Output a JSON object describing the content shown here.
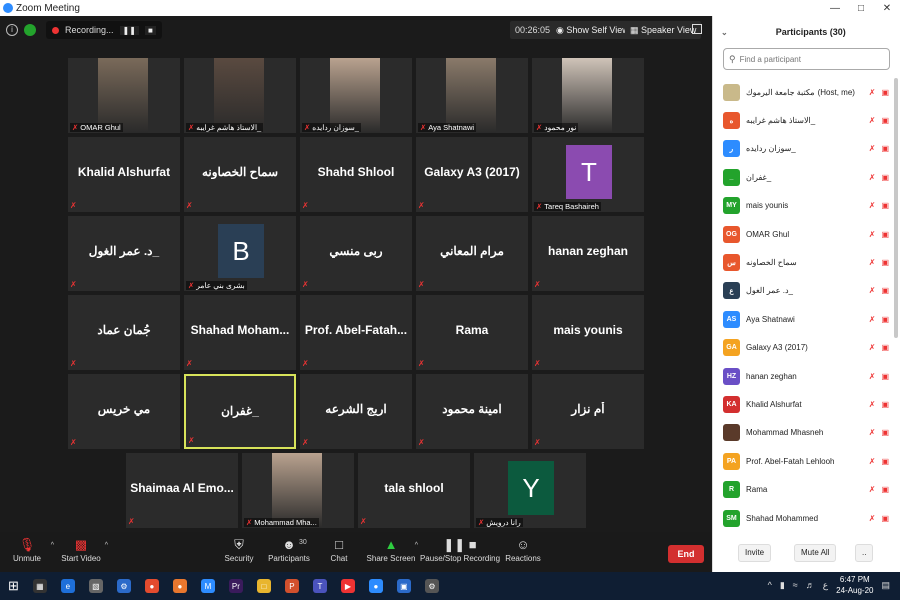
{
  "window": {
    "title": "Zoom Meeting"
  },
  "topbar": {
    "recording_label": "Recording...",
    "pause_icon": "pause-icon",
    "stop_icon": "stop-icon",
    "timer": "00:26:05",
    "self_view_label": "Show Self View",
    "speaker_view_label": "Speaker View"
  },
  "tiles": [
    {
      "name": "",
      "label": "OMAR Ghul",
      "kind": "video"
    },
    {
      "name": "",
      "label": "الاستاذ هاشم غرايبه_",
      "kind": "video"
    },
    {
      "name": "",
      "label": "سوزان ردايده_",
      "kind": "video"
    },
    {
      "name": "",
      "label": "Aya Shatnawi",
      "kind": "video"
    },
    {
      "name": "",
      "label": "نور محمود",
      "kind": "video"
    },
    {
      "name": "Khalid Alshurfat",
      "label": "",
      "kind": "text"
    },
    {
      "name": "سماح الخصاونه",
      "label": "",
      "kind": "text"
    },
    {
      "name": "Shahd Shlool",
      "label": "",
      "kind": "text"
    },
    {
      "name": "Galaxy A3 (2017)",
      "label": "",
      "kind": "text"
    },
    {
      "name": "",
      "label": "Tareq Bashaireh",
      "kind": "avatar",
      "letter": "T"
    },
    {
      "name": "د. عمر الغول_",
      "label": "",
      "kind": "text"
    },
    {
      "name": "",
      "label": "بشرى بني عامر",
      "kind": "avatar",
      "letter": "B"
    },
    {
      "name": "ربى منسي",
      "label": "",
      "kind": "text"
    },
    {
      "name": "مرام المعاني",
      "label": "",
      "kind": "text"
    },
    {
      "name": "hanan zeghan",
      "label": "",
      "kind": "text"
    },
    {
      "name": "جُمان عماد",
      "label": "",
      "kind": "text"
    },
    {
      "name": "Shahad  Moham...",
      "label": "",
      "kind": "text"
    },
    {
      "name": "Prof.  Abel-Fatah...",
      "label": "",
      "kind": "text"
    },
    {
      "name": "Rama",
      "label": "",
      "kind": "text"
    },
    {
      "name": "mais younis",
      "label": "",
      "kind": "text"
    },
    {
      "name": "مي خريس",
      "label": "",
      "kind": "text"
    },
    {
      "name": "غفران_",
      "label": "",
      "kind": "text",
      "active": true
    },
    {
      "name": "اريج الشرعه",
      "label": "",
      "kind": "text"
    },
    {
      "name": "امينة محمود",
      "label": "",
      "kind": "text"
    },
    {
      "name": "أم نزار",
      "label": "",
      "kind": "text"
    },
    {
      "name": "Shaimaa  Al  Emo...",
      "label": "",
      "kind": "text"
    },
    {
      "name": "",
      "label": "Mohammad Mha...",
      "kind": "video"
    },
    {
      "name": "tala shlool",
      "label": "",
      "kind": "text"
    },
    {
      "name": "",
      "label": "رانا درويش",
      "kind": "avatar",
      "letter": "Y"
    }
  ],
  "toolbar": {
    "unmute": "Unmute",
    "start_video": "Start Video",
    "security": "Security",
    "participants": "Participants",
    "participants_count": "30",
    "chat": "Chat",
    "share_screen": "Share Screen",
    "pause_recording": "Pause/Stop Recording",
    "reactions": "Reactions",
    "end": "End"
  },
  "panel": {
    "title": "Participants (30)",
    "search_placeholder": "Find a participant",
    "invite": "Invite",
    "mute_all": "Mute All",
    "more": "..",
    "participants": [
      {
        "initials": "",
        "name": "مكتبة جامعة اليرموك",
        "suffix": "(Host, me)",
        "color": "#c9b98a"
      },
      {
        "initials": "ه",
        "name": "الاستاذ هاشم غرايبه_",
        "suffix": "",
        "color": "#e8572d"
      },
      {
        "initials": "ر",
        "name": "سوزان ردايده_",
        "suffix": "",
        "color": "#2d8cff"
      },
      {
        "initials": "_",
        "name": "غفران_",
        "suffix": "",
        "color": "#23a32c"
      },
      {
        "initials": "MY",
        "name": "mais younis",
        "suffix": "",
        "color": "#23a32c"
      },
      {
        "initials": "OG",
        "name": "OMAR Ghul",
        "suffix": "",
        "color": "#e8572d"
      },
      {
        "initials": "س",
        "name": "سماح الخصاونه",
        "suffix": "",
        "color": "#e8572d"
      },
      {
        "initials": "ع",
        "name": "د. عمر الغول_",
        "suffix": "",
        "color": "#2a3f55"
      },
      {
        "initials": "AS",
        "name": "Aya Shatnawi",
        "suffix": "",
        "color": "#2d8cff"
      },
      {
        "initials": "GA",
        "name": "Galaxy A3 (2017)",
        "suffix": "",
        "color": "#f4a321"
      },
      {
        "initials": "HZ",
        "name": "hanan zeghan",
        "suffix": "",
        "color": "#6a4fc6"
      },
      {
        "initials": "KA",
        "name": "Khalid Alshurfat",
        "suffix": "",
        "color": "#d32f2f"
      },
      {
        "initials": "",
        "name": "Mohammad Mhasneh",
        "suffix": "",
        "color": "#5a3a2a"
      },
      {
        "initials": "PA",
        "name": "Prof. Abel-Fatah Lehlooh",
        "suffix": "",
        "color": "#f4a321"
      },
      {
        "initials": "R",
        "name": "Rama",
        "suffix": "",
        "color": "#23a32c"
      },
      {
        "initials": "SM",
        "name": "Shahad Mohammed",
        "suffix": "",
        "color": "#23a32c"
      }
    ]
  },
  "taskbar": {
    "time": "6:47 PM",
    "date": "24-Aug-20",
    "lang": "ع"
  }
}
